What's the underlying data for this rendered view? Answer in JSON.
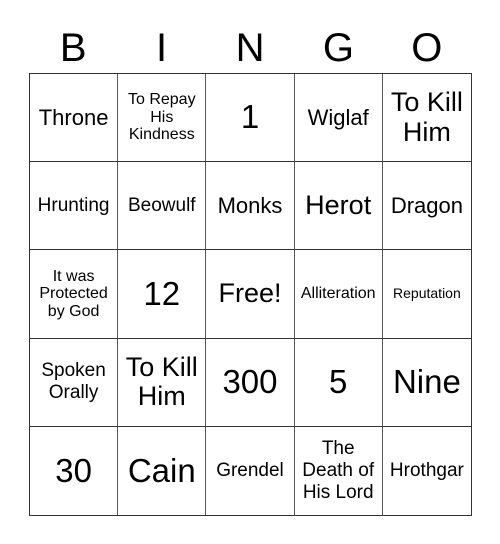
{
  "header": [
    "B",
    "I",
    "N",
    "G",
    "O"
  ],
  "cells": [
    {
      "text": "Throne",
      "size": "s4"
    },
    {
      "text": "To Repay His Kindness",
      "size": "s2"
    },
    {
      "text": "1",
      "size": "s6"
    },
    {
      "text": "Wiglaf",
      "size": "s4"
    },
    {
      "text": "To Kill Him",
      "size": "s5"
    },
    {
      "text": "Hrunting",
      "size": "s3"
    },
    {
      "text": "Beowulf",
      "size": "s3"
    },
    {
      "text": "Monks",
      "size": "s4"
    },
    {
      "text": "Herot",
      "size": "s5"
    },
    {
      "text": "Dragon",
      "size": "s4"
    },
    {
      "text": "It was Protected by God",
      "size": "s2"
    },
    {
      "text": "12",
      "size": "s6"
    },
    {
      "text": "Free!",
      "size": "s5"
    },
    {
      "text": "Alliteration",
      "size": "s2"
    },
    {
      "text": "Reputation",
      "size": "s1"
    },
    {
      "text": "Spoken Orally",
      "size": "s3"
    },
    {
      "text": "To Kill Him",
      "size": "s5"
    },
    {
      "text": "300",
      "size": "s6"
    },
    {
      "text": "5",
      "size": "s6"
    },
    {
      "text": "Nine",
      "size": "s6"
    },
    {
      "text": "30",
      "size": "s6"
    },
    {
      "text": "Cain",
      "size": "s6"
    },
    {
      "text": "Grendel",
      "size": "s3"
    },
    {
      "text": "The Death of His Lord",
      "size": "s3"
    },
    {
      "text": "Hrothgar",
      "size": "s3"
    }
  ]
}
